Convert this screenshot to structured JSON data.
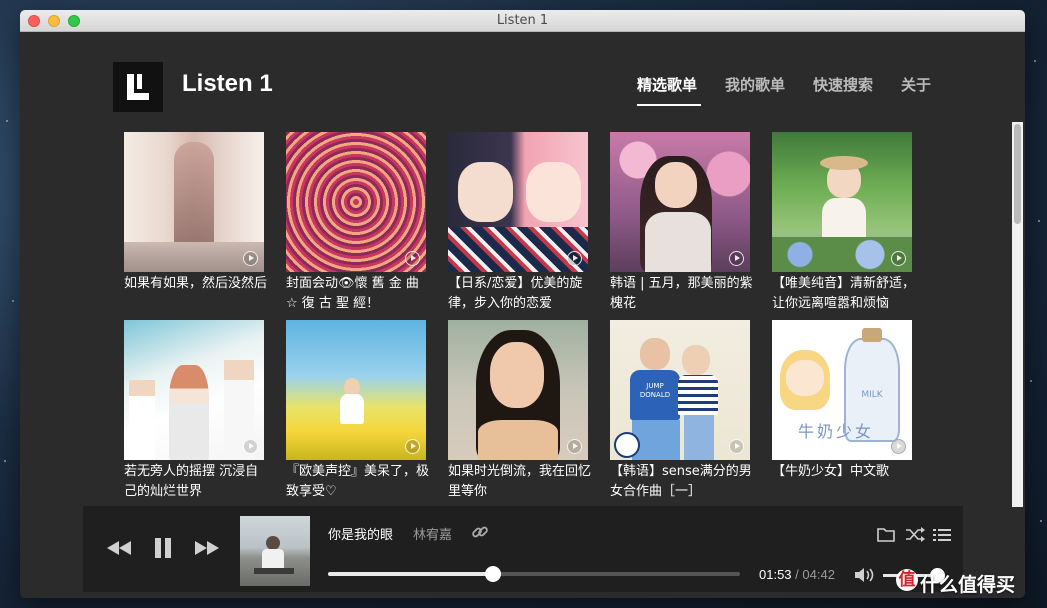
{
  "window": {
    "title": "Listen 1"
  },
  "app": {
    "name": "Listen 1"
  },
  "nav": [
    {
      "label": "精选歌单",
      "active": true
    },
    {
      "label": "我的歌单",
      "active": false
    },
    {
      "label": "快速搜索",
      "active": false
    },
    {
      "label": "关于",
      "active": false
    }
  ],
  "playlists": [
    {
      "title": "如果有如果，然后没然后"
    },
    {
      "title": "封面会动👁懷 舊 金 曲 ☆ 復 古 聖 經！"
    },
    {
      "title": "【日系/恋爱】优美的旋律，步入你的恋爱"
    },
    {
      "title": "韩语 | 五月，那美丽的紫槐花"
    },
    {
      "title": "【唯美纯音】清新舒适，让你远离喧嚣和烦恼"
    },
    {
      "title": "若无旁人的摇摆 沉浸自己的灿烂世界"
    },
    {
      "title": "『欧美声控』美呆了，极致享受♡"
    },
    {
      "title": "如果时光倒流，我在回忆里等你"
    },
    {
      "title": "【韩语】sense满分的男女合作曲［一］"
    },
    {
      "title": "【牛奶少女】中文歌"
    }
  ],
  "cover_art": {
    "milk_label": "MILK",
    "milk_caption": "牛奶少女",
    "jump_label": "JUMP",
    "donald_label": "DONALD"
  },
  "player": {
    "song": "你是我的眼",
    "artist": "林宥嘉",
    "current_time": "01:53",
    "separator": "/",
    "total_time": "04:42",
    "progress": 0.4,
    "volume": 0.9
  },
  "watermark": {
    "badge": "值",
    "text": "什么值得买"
  },
  "colors": {
    "accent": "#ffffff",
    "player_bg": "#1f1f1f",
    "window_bg": "#2b2b2b"
  }
}
